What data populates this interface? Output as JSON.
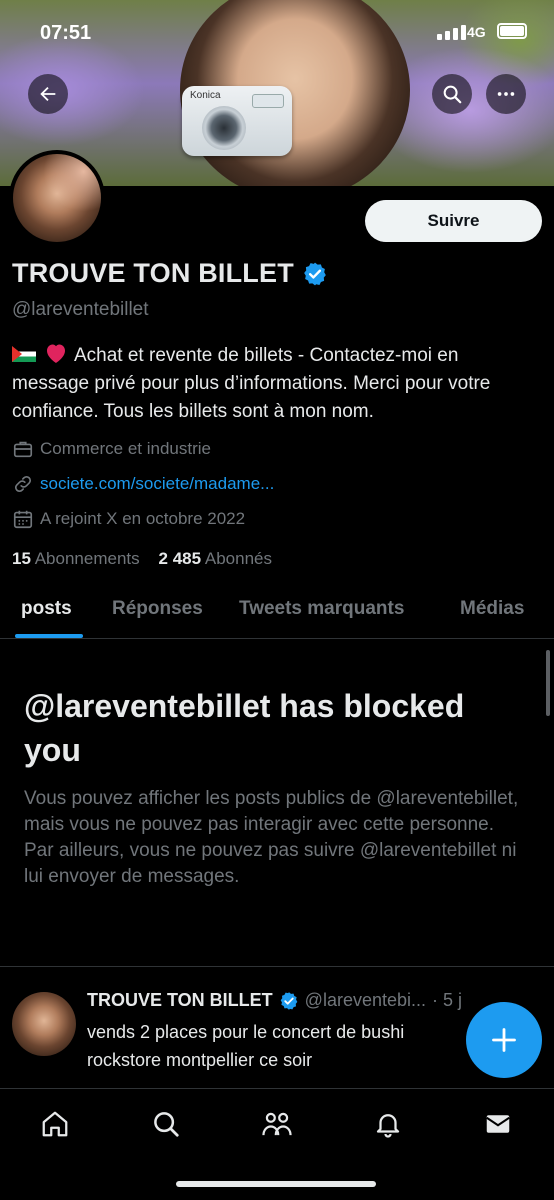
{
  "status_bar": {
    "time": "07:51",
    "network": "4G"
  },
  "banner": {
    "camera_brand": "Konica"
  },
  "profile": {
    "follow_label": "Suivre",
    "name": "TROUVE TON BILLET",
    "handle": "@lareventebillet",
    "bio": "Achat et revente de billets - Contactez-moi en message privé pour plus d’informations. Merci pour votre confiance. Tous les billets sont à mon nom.",
    "category": "Commerce et industrie",
    "link": "societe.com/societe/madame...",
    "joined": "A rejoint X en octobre 2022",
    "following_count": "15",
    "following_label": "Abonnements",
    "followers_count": "2 485",
    "followers_label": "Abonnés"
  },
  "tabs": [
    {
      "label": "posts",
      "active": true
    },
    {
      "label": "Réponses"
    },
    {
      "label": "Tweets marquants"
    },
    {
      "label": "Médias"
    }
  ],
  "blocked": {
    "title": "@lareventebillet has blocked you",
    "message": "Vous pouvez afficher les posts publics de @lareventebillet, mais vous ne pouvez pas interagir avec cette personne. Par ailleurs, vous ne pouvez pas suivre @lareventebillet ni lui envoyer de messages."
  },
  "tweet": {
    "author": "TROUVE TON BILLET",
    "handle": "@lareventebi...",
    "time": "· 5 j",
    "text": "vends 2 places pour le concert de bushi rockstore montpellier ce soir"
  },
  "colors": {
    "accent": "#1d9bf0",
    "background": "#000000",
    "muted": "#71767b"
  }
}
